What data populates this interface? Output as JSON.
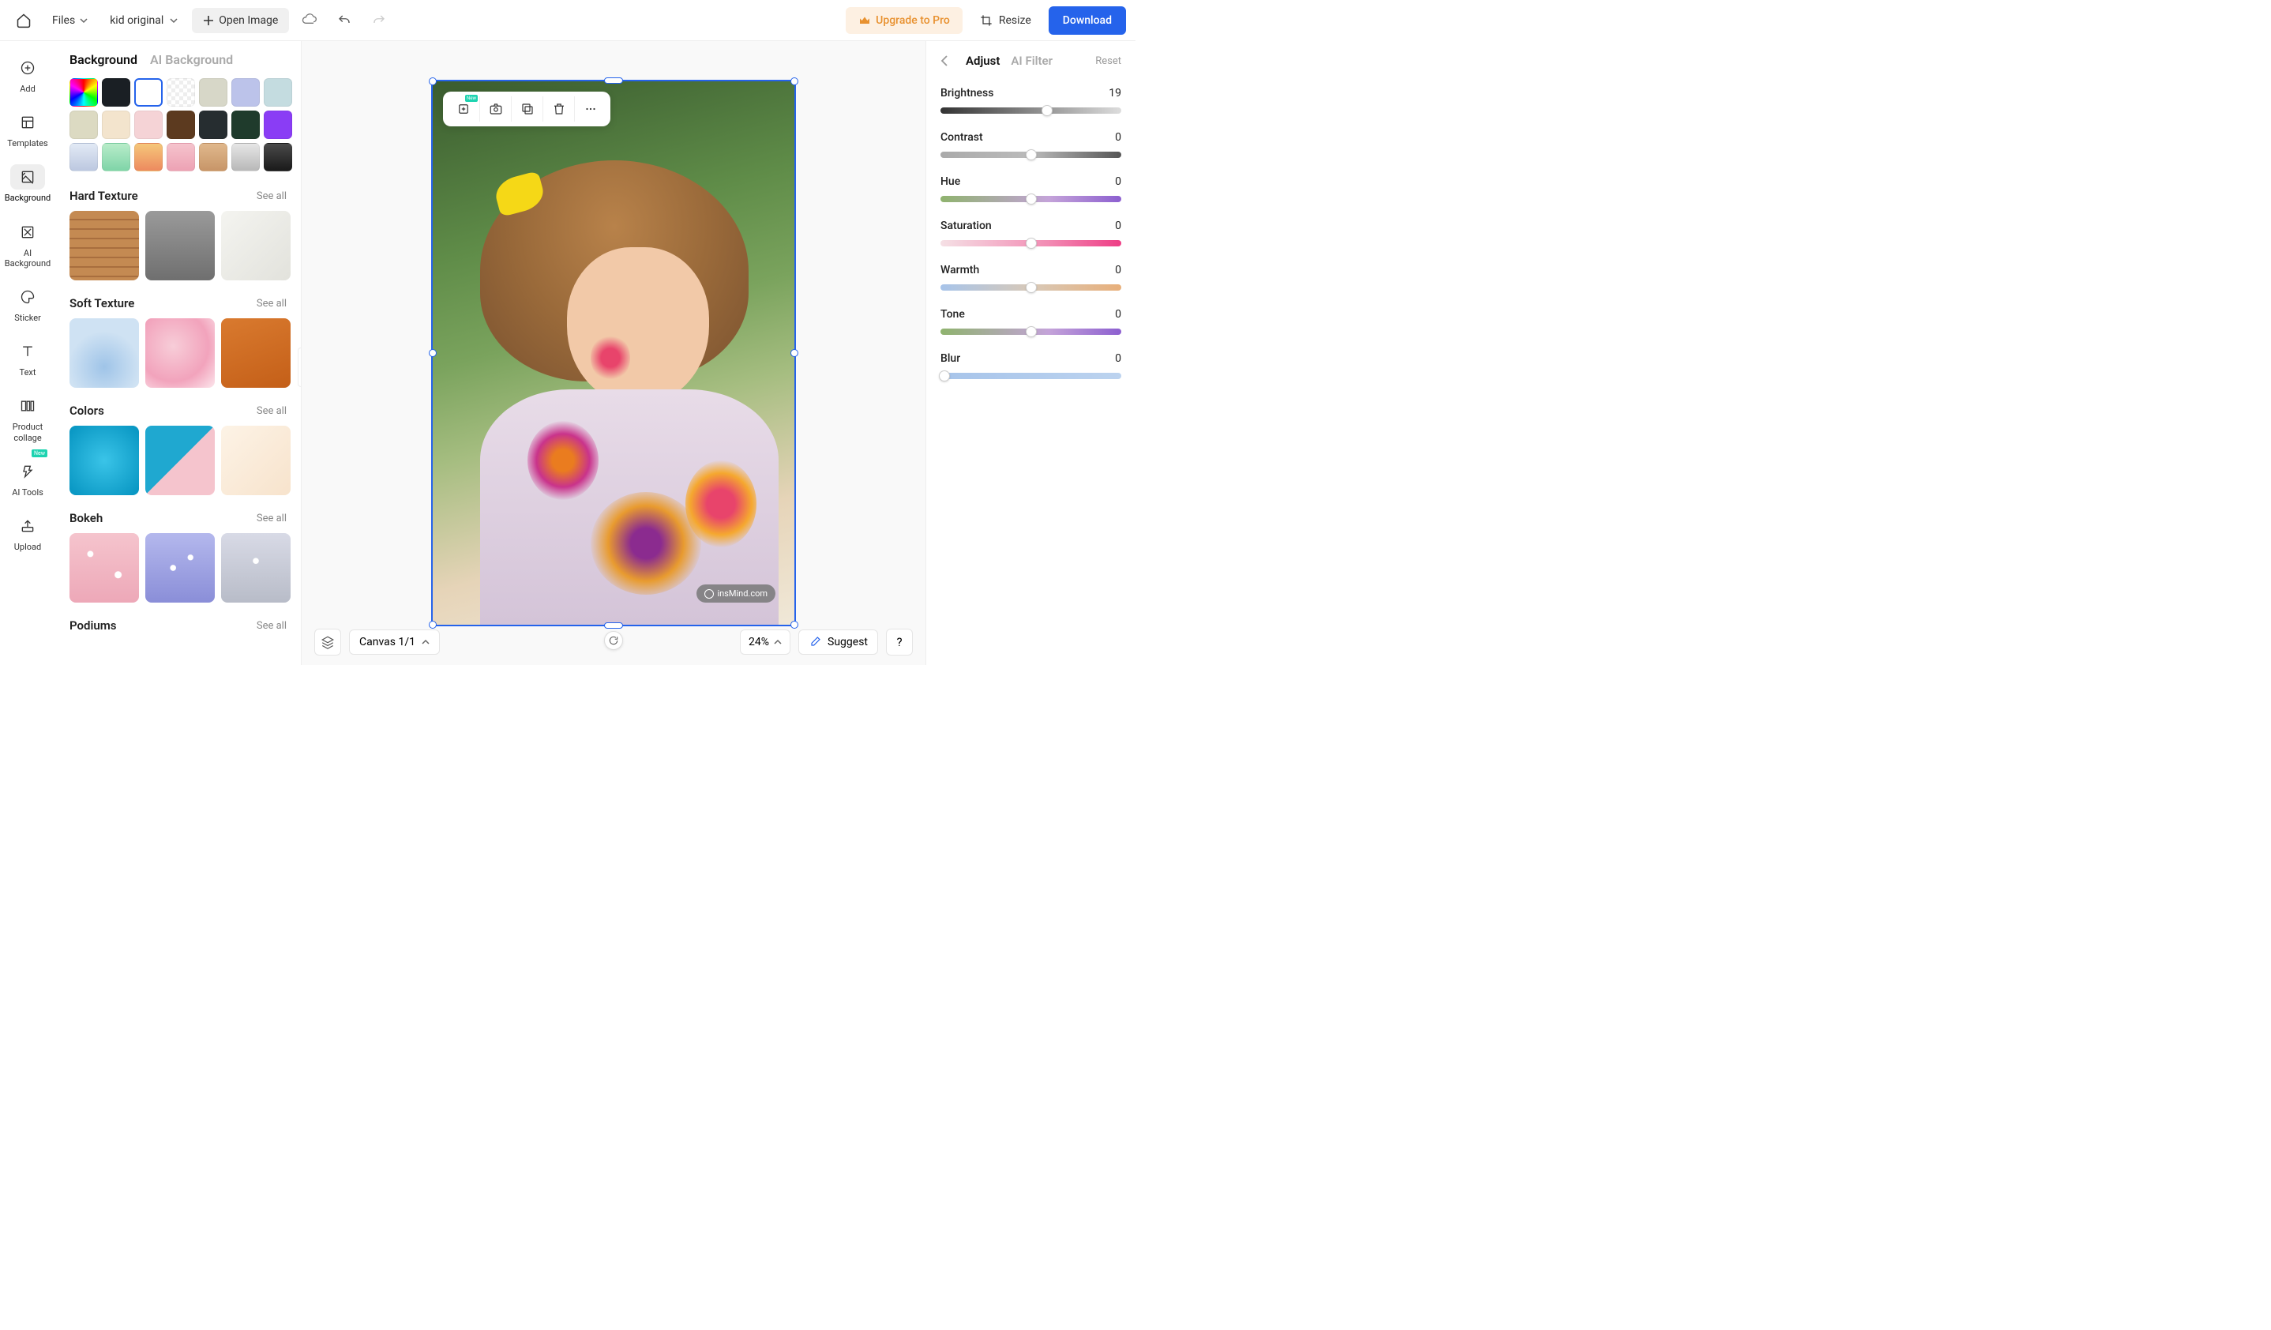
{
  "topbar": {
    "files_label": "Files",
    "filename": "kid original",
    "open_image": "Open Image",
    "upgrade": "Upgrade to Pro",
    "resize": "Resize",
    "download": "Download"
  },
  "leftnav": [
    {
      "id": "add",
      "label": "Add"
    },
    {
      "id": "templates",
      "label": "Templates"
    },
    {
      "id": "background",
      "label": "Background",
      "active": true
    },
    {
      "id": "ai-background",
      "label": "AI Background"
    },
    {
      "id": "sticker",
      "label": "Sticker"
    },
    {
      "id": "text",
      "label": "Text"
    },
    {
      "id": "product-collage",
      "label": "Product collage"
    },
    {
      "id": "ai-tools",
      "label": "AI Tools",
      "new": true
    },
    {
      "id": "upload",
      "label": "Upload"
    }
  ],
  "panel": {
    "tabs": {
      "background": "Background",
      "ai": "AI Background"
    },
    "swatches": [
      {
        "bg": "conic-gradient(red,yellow,lime,cyan,blue,magenta,red)"
      },
      {
        "bg": "#1a1f24"
      },
      {
        "bg": "#ffffff",
        "selected": true
      },
      {
        "bg": "repeating-conic-gradient(#eee 0 25%, #fff 0 50%) 0/10px 10px"
      },
      {
        "bg": "#d7d7c8"
      },
      {
        "bg": "#bcc3ea"
      },
      {
        "bg": "#c4dce0"
      },
      {
        "bg": "#dcdac2"
      },
      {
        "bg": "#f3e4cd"
      },
      {
        "bg": "#f5d3d6"
      },
      {
        "bg": "#5c3a1f"
      },
      {
        "bg": "#262d30"
      },
      {
        "bg": "#1f3b2c"
      },
      {
        "bg": "#8a3df5"
      },
      {
        "bg": "linear-gradient(180deg,#e2eaf5,#bcc8e0)"
      },
      {
        "bg": "linear-gradient(180deg,#b8ecc9,#7fd4a8)"
      },
      {
        "bg": "linear-gradient(180deg,#f5c77a,#ed8a5f)"
      },
      {
        "bg": "linear-gradient(180deg,#f5c4cd,#eda2b4)"
      },
      {
        "bg": "linear-gradient(180deg,#e0b88c,#c79568)"
      },
      {
        "bg": "linear-gradient(180deg,#e6e6e6,#b8b8b8)"
      },
      {
        "bg": "linear-gradient(180deg,#4a4a4a,#1a1a1a)"
      }
    ],
    "see_all": "See all",
    "sections": [
      {
        "title": "Hard Texture",
        "thumbs": [
          "repeating-linear-gradient(180deg,#c48a52 0 10px,#a86e3e 10px 12px)",
          "linear-gradient(180deg,#9a9a9a,#6f6f6f)",
          "linear-gradient(135deg,#f4f4f0,#e2e2dc)"
        ]
      },
      {
        "title": "Soft Texture",
        "thumbs": [
          "radial-gradient(circle at 50% 70%, #9fc4e8 0%, #cfe2f3 60%)",
          "radial-gradient(ellipse at 40% 40%, #f7cdd8 0%, #f2a3bc 60%, #fce6ec 100%)",
          "linear-gradient(160deg,#d97a2f,#c45f18)"
        ]
      },
      {
        "title": "Colors",
        "thumbs": [
          "radial-gradient(circle,#3ac4e8 0%,#0a98c4 90%)",
          "linear-gradient(135deg,#1fa8d0 0 50%,#f5c4cd 50% 100%)",
          "linear-gradient(135deg,#fdf3e6,#f7e3cc)"
        ]
      },
      {
        "title": "Bokeh",
        "thumbs": [
          "radial-gradient(circle at 30% 30%,#fff 0 4%,transparent 5%),radial-gradient(circle at 70% 60%,#fff 0 5%,transparent 6%),linear-gradient(#f5c4cd,#eda8b8)",
          "radial-gradient(circle at 40% 50%,#fff 0 5%,transparent 6%),radial-gradient(circle at 65% 35%,#fff 0 4%,transparent 5%),linear-gradient(#b4b8ed,#8a8ed8)",
          "radial-gradient(circle at 50% 40%,#fff 0 5%,transparent 6%),linear-gradient(#d8dae6,#b8bcc8)"
        ]
      },
      {
        "title": "Podiums",
        "thumbs": []
      }
    ]
  },
  "canvas": {
    "watermark": "insMind.com",
    "canvas_label": "Canvas 1/1",
    "zoom": "24%",
    "suggest": "Suggest",
    "help": "?"
  },
  "right": {
    "tabs": {
      "adjust": "Adjust",
      "filter": "AI Filter"
    },
    "reset": "Reset",
    "sliders": [
      {
        "label": "Brightness",
        "value": 19,
        "pos": 59,
        "track": "track-bright"
      },
      {
        "label": "Contrast",
        "value": 0,
        "pos": 50,
        "track": "track-contrast"
      },
      {
        "label": "Hue",
        "value": 0,
        "pos": 50,
        "track": "track-hue"
      },
      {
        "label": "Saturation",
        "value": 0,
        "pos": 50,
        "track": "track-sat"
      },
      {
        "label": "Warmth",
        "value": 0,
        "pos": 50,
        "track": "track-warm"
      },
      {
        "label": "Tone",
        "value": 0,
        "pos": 50,
        "track": "track-tone"
      },
      {
        "label": "Blur",
        "value": 0,
        "pos": 2,
        "track": "track-blur"
      }
    ]
  }
}
